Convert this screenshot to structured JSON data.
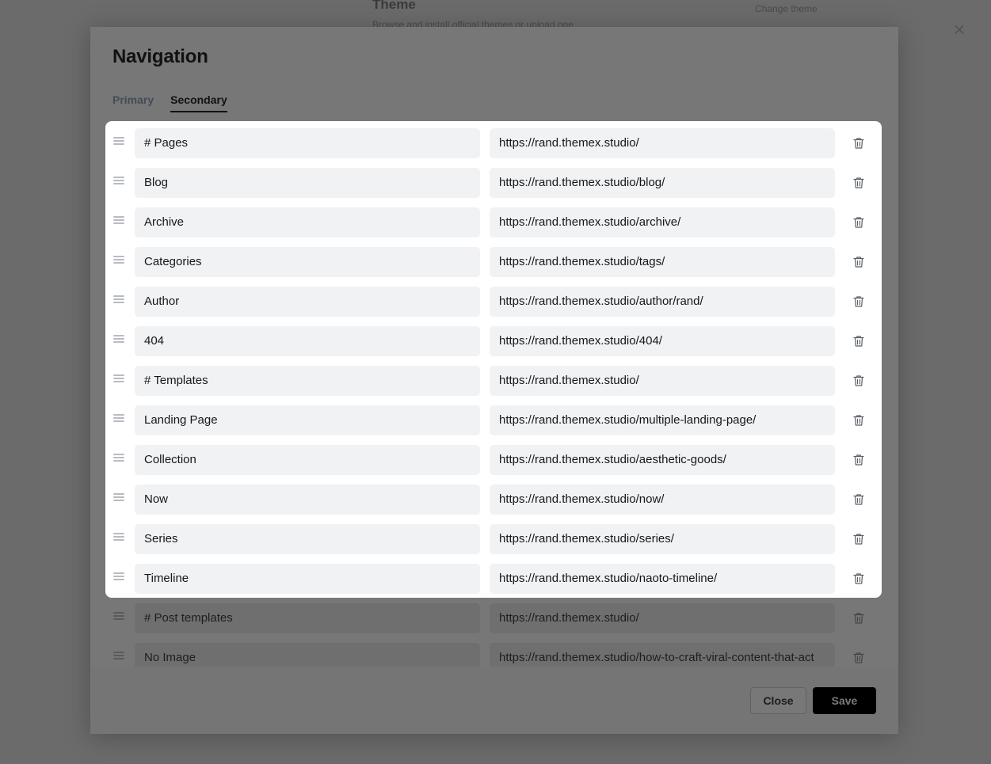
{
  "background": {
    "section_title": "Theme",
    "section_subtitle": "Browse and install official themes or upload one",
    "section_link": "Change theme"
  },
  "modal": {
    "title": "Navigation",
    "tabs": [
      {
        "label": "Primary",
        "active": false
      },
      {
        "label": "Secondary",
        "active": true
      }
    ],
    "items": [
      {
        "label": "# Pages",
        "url": "https://rand.themex.studio/"
      },
      {
        "label": "Blog",
        "url": "https://rand.themex.studio/blog/"
      },
      {
        "label": "Archive",
        "url": "https://rand.themex.studio/archive/"
      },
      {
        "label": "Categories",
        "url": "https://rand.themex.studio/tags/"
      },
      {
        "label": "Author",
        "url": "https://rand.themex.studio/author/rand/"
      },
      {
        "label": "404",
        "url": "https://rand.themex.studio/404/"
      },
      {
        "label": "# Templates",
        "url": "https://rand.themex.studio/"
      },
      {
        "label": "Landing Page",
        "url": "https://rand.themex.studio/multiple-landing-page/"
      },
      {
        "label": "Collection",
        "url": "https://rand.themex.studio/aesthetic-goods/"
      },
      {
        "label": "Now",
        "url": "https://rand.themex.studio/now/"
      },
      {
        "label": "Series",
        "url": "https://rand.themex.studio/series/"
      },
      {
        "label": "Timeline",
        "url": "https://rand.themex.studio/naoto-timeline/"
      }
    ],
    "dim_items": [
      {
        "label": "# Post templates",
        "url": "https://rand.themex.studio/"
      },
      {
        "label": "No Image",
        "url": "https://rand.themex.studio/how-to-craft-viral-content-that-act"
      }
    ],
    "close_label": "Close",
    "save_label": "Save"
  },
  "icons": {
    "drag": "drag-handle-icon",
    "delete": "trash-icon",
    "close": "close-icon"
  },
  "colors": {
    "overlay": "#6b6b6b",
    "card": "#ffffff",
    "field": "#f1f2f4",
    "save_button": "#000000"
  }
}
